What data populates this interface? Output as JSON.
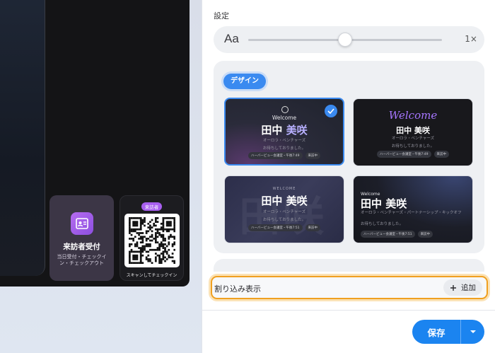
{
  "left_preview": {
    "visitor_tile": {
      "title": "来訪者受付",
      "subtitle": "当日受付・チェックイン・チェックアウト"
    },
    "qr_tile": {
      "badge": "来訪者",
      "caption": "スキャンしてチェックイン"
    }
  },
  "settings": {
    "section_label": "設定",
    "text_size": {
      "icon_label": "Aa",
      "scale_label": "1×",
      "value": 0.5
    },
    "design": {
      "chip_label": "デザイン",
      "selected_index": 0,
      "cards": [
        {
          "welcome": "Welcome",
          "surname": "田中",
          "given": "美咲",
          "company": "オーロラ・ベンチャーズ",
          "message": "お待ちしておりました。",
          "pill_meeting": "ハーバービュー会議室・午後7:49",
          "pill_status": "来訪中"
        },
        {
          "welcome": "Welcome",
          "name": "田中 美咲",
          "company": "オーロラ・ベンチャーズ",
          "message": "お待ちしておりました。",
          "pill_meeting": "ハーバービュー会議室・午後7:49",
          "pill_status": "来訪中"
        },
        {
          "welcome": "WELCOME",
          "bg_text": "田咲",
          "name": "田中 美咲",
          "company": "オーロラ・ベンチャーズ",
          "message": "お待ちしておりました。",
          "pill_meeting": "ハーバービュー会議室・午後7:51",
          "pill_status": "来訪中"
        },
        {
          "welcome": "Welcome",
          "name": "田中 美咲",
          "company": "オーロラ・ベンチャーズ・パートナーシップ・キックオフ",
          "message": "お待ちしておりました。",
          "pill_meeting": "ハーバービュー会議室・午後7:51",
          "pill_status": "来訪中"
        }
      ]
    },
    "interrupt": {
      "label": "割り込み表示",
      "add_label": "追加"
    },
    "save_label": "保存",
    "colors": {
      "accent": "#1b84f0",
      "highlight": "#f0a020",
      "given_name": "#b8b0ff"
    }
  }
}
